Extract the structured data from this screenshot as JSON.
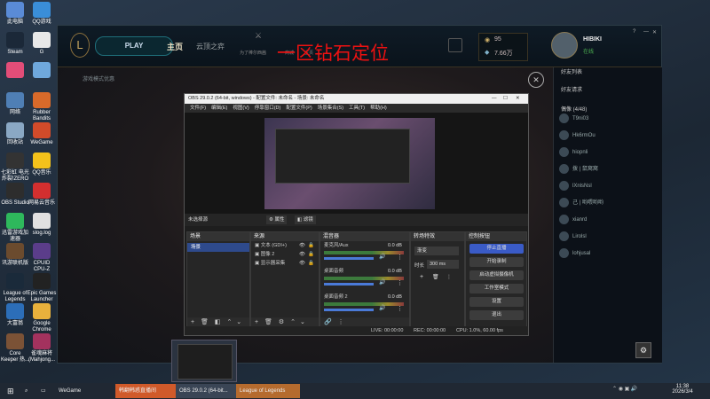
{
  "desktop_icons": [
    {
      "label": "此电脑",
      "color": "#5a8bd6"
    },
    {
      "label": "QQ游戏",
      "color": "#3a8ed8"
    },
    {
      "label": "Steam",
      "color": "#1b2838"
    },
    {
      "label": "G",
      "color": "#e8e8e8"
    },
    {
      "label": "",
      "color": "#e24d78"
    },
    {
      "label": "",
      "color": "#6fa8dc"
    },
    {
      "label": "网络",
      "color": "#4f7fb5"
    },
    {
      "label": "Rubber Bandits",
      "color": "#d86a2a"
    },
    {
      "label": "回收站",
      "color": "#8aa8c4"
    },
    {
      "label": "WeGame",
      "color": "#d24b2a"
    },
    {
      "label": "七彩虹 电光炸裂!ZERO",
      "color": "#333"
    },
    {
      "label": "QQ音乐",
      "color": "#f3c21b"
    },
    {
      "label": "OBS Studio",
      "color": "#2d2d2d"
    },
    {
      "label": "网易云音乐",
      "color": "#d32f2f"
    },
    {
      "label": "迅雷游戏加速器",
      "color": "#2eb85c"
    },
    {
      "label": "slog.log",
      "color": "#e0e0e0"
    },
    {
      "label": "讯游联机版",
      "color": "#6b4b2e"
    },
    {
      "label": "CPUID CPU-Z",
      "color": "#5b3d8a"
    },
    {
      "label": "League of Legends",
      "color": "#1a2a3a"
    },
    {
      "label": "Epic Games Launcher",
      "color": "#222"
    },
    {
      "label": "大富翁",
      "color": "#2c6eb8"
    },
    {
      "label": "Google Chrome",
      "color": "#e8b13c"
    },
    {
      "label": "Core Keeper 热...",
      "color": "#7b5236"
    },
    {
      "label": "雀魂麻将(Mahjong...",
      "color": "#a3325e"
    }
  ],
  "lol": {
    "play_label": "PLAY",
    "tabs": [
      "主页",
      "云顶之弈"
    ],
    "subtabs": [
      "为了棒尔西茜",
      "商城",
      "主页"
    ],
    "overlay_text": "一区钻石定位",
    "rp": "95",
    "be": "7.66万",
    "username": "HIBIKI",
    "status": "在线",
    "side_headers": [
      "好友列表",
      "好友请求",
      "偶像 (4/48)"
    ],
    "friends": [
      "T9ni03",
      "Hk6rmOu",
      "hiopnli",
      "拨 | 鼠窝窝",
      "lXnlsNsl",
      "己 | 哟喂哟哟",
      "xianrd",
      "Lirolsl",
      "lohjusal"
    ],
    "left_panel": "游戏模式优惠"
  },
  "obs": {
    "title": "OBS 29.0.2 (64-bit, windows) - 配置文件: 未命名 - 场景: 未命名",
    "menu": [
      "文件(F)",
      "编辑(E)",
      "视图(V)",
      "停靠窗口(D)",
      "配置文件(P)",
      "场景集合(S)",
      "工具(T)",
      "帮助(H)"
    ],
    "no_source": "未选择源",
    "props_label": "属性",
    "filters_label": "滤镜",
    "scenes_title": "场景",
    "scene_items": [
      "场景"
    ],
    "sources_title": "来源",
    "source_items": [
      "文本 (GDI+)",
      "图像 2",
      "显示器采集"
    ],
    "mixer_title": "混音器",
    "mixer_items": [
      {
        "name": "麦克风/Aux",
        "db": "0.0 dB"
      },
      {
        "name": "桌面音频",
        "db": "0.0 dB"
      },
      {
        "name": "桌面音频 2",
        "db": "0.0 dB"
      }
    ],
    "transitions_title": "转场特效",
    "transition_value": "渐变",
    "duration_label": "时长",
    "duration_value": "300 ms",
    "controls_title": "控制按钮",
    "controls": [
      "停止直播",
      "开始录制",
      "启动虚拟摄像机",
      "工作室模式",
      "设置",
      "退出"
    ],
    "status_live": "LIVE: 00:00:00",
    "status_rec": "REC: 00:00:00",
    "status_cpu": "CPU: 1.0%, 60.00 fps"
  },
  "taskbar": {
    "items": [
      "WeGame",
      "韩翻韩惑直播间",
      "OBS 29.0.2 (64-bit...",
      "League of Legends"
    ],
    "time": "11:38",
    "date": "2026/3/4"
  }
}
